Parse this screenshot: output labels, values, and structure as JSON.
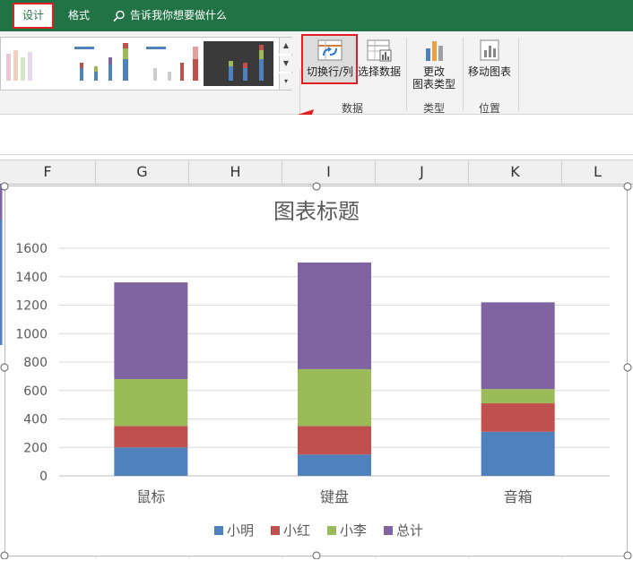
{
  "tabs": {
    "design": "设计",
    "format": "格式"
  },
  "tell_me": "告诉我你想要做什么",
  "ribbon": {
    "switch_row_col": "切换行/列",
    "select_data": "选择数据",
    "change_type_line1": "更改",
    "change_type_line2": "图表类型",
    "move_chart": "移动图表",
    "group_data": "数据",
    "group_type": "类型",
    "group_location": "位置"
  },
  "columns": [
    "F",
    "G",
    "H",
    "I",
    "J",
    "K",
    "L"
  ],
  "colors": {
    "ribbon_green": "#217346",
    "highlight_red": "#e02020",
    "series_xiaoming": "#4f81bd",
    "series_xiaohong": "#c0504d",
    "series_xiaoli": "#9bbb59",
    "series_total": "#8064a2"
  },
  "chart_data": {
    "type": "bar",
    "stacked": true,
    "title": "图表标题",
    "categories": [
      "鼠标",
      "键盘",
      "音箱"
    ],
    "series": [
      {
        "name": "小明",
        "values": [
          200,
          150,
          310
        ]
      },
      {
        "name": "小红",
        "values": [
          150,
          200,
          200
        ]
      },
      {
        "name": "小李",
        "values": [
          330,
          400,
          100
        ]
      },
      {
        "name": "总计",
        "values": [
          680,
          750,
          610
        ]
      }
    ],
    "ylim": [
      0,
      1600
    ],
    "yticks": [
      "0",
      "200",
      "400",
      "600",
      "800",
      "1000",
      "1200",
      "1400",
      "1600"
    ],
    "grid": true,
    "legend": "bottom"
  }
}
